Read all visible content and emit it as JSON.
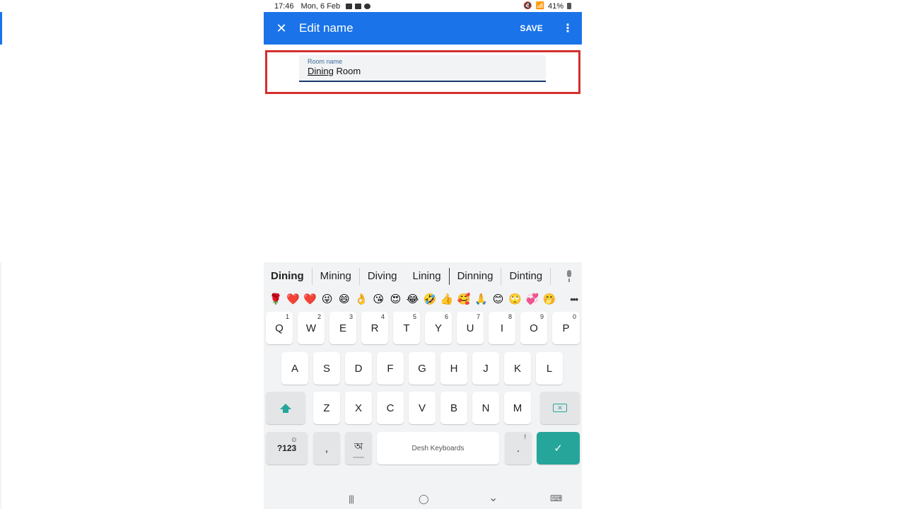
{
  "status_bar": {
    "time": "17:46",
    "date": "Mon, 6 Feb",
    "notification_icons": [
      "gallery-icon",
      "youtube-icon",
      "chat-icon"
    ],
    "system_icons": [
      "mute-icon",
      "wifi-icon"
    ],
    "battery": "41%"
  },
  "app_bar": {
    "close_icon": "✕",
    "title": "Edit name",
    "save_label": "SAVE",
    "more_icon": "⋮",
    "color": "#1a73e8"
  },
  "field": {
    "label": "Room name",
    "value_underlined": "Dining",
    "value_rest": " Room"
  },
  "highlight_color": "#d32f2f",
  "keyboard": {
    "suggestions": [
      "Dining",
      "Mining",
      "Diving",
      "Lining",
      "Dinning",
      "Dinting"
    ],
    "emojis": [
      "🌹",
      "❤️",
      "❤️",
      "😜",
      "😄",
      "👌",
      "😘",
      "😍",
      "😂",
      "🤣",
      "👍",
      "🥰",
      "🙏",
      "😊",
      "🙄",
      "💞",
      "🤭"
    ],
    "emoji_more": "•••",
    "row1": [
      {
        "key": "Q",
        "hint": "1"
      },
      {
        "key": "W",
        "hint": "2"
      },
      {
        "key": "E",
        "hint": "3"
      },
      {
        "key": "R",
        "hint": "4"
      },
      {
        "key": "T",
        "hint": "5"
      },
      {
        "key": "Y",
        "hint": "6"
      },
      {
        "key": "U",
        "hint": "7"
      },
      {
        "key": "I",
        "hint": "8"
      },
      {
        "key": "O",
        "hint": "9"
      },
      {
        "key": "P",
        "hint": "0"
      }
    ],
    "row2": [
      "A",
      "S",
      "D",
      "F",
      "G",
      "H",
      "J",
      "K",
      "L"
    ],
    "row3": [
      "Z",
      "X",
      "C",
      "V",
      "B",
      "N",
      "M"
    ],
    "symbols_label": "?123",
    "symbols_hint": "☺",
    "comma": ",",
    "lang_key": "অ",
    "space_label": "Desh Keyboards",
    "period": ".",
    "period_hint": "!",
    "backspace": "✕",
    "enter": "✓",
    "accent": "#26a69a"
  },
  "nav_bar": {
    "recents": "|||",
    "home": "◯",
    "back": "⌄",
    "keyboard": "⌨"
  }
}
